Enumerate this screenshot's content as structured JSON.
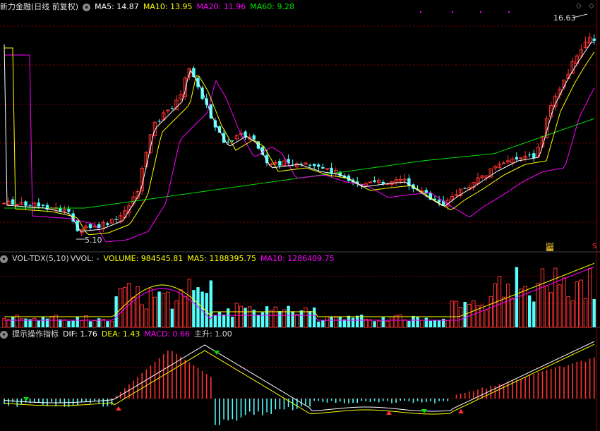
{
  "colors": {
    "up": "#ff3232",
    "down": "#54ffff",
    "ma5": "#ffffff",
    "ma10": "#ffff00",
    "ma20": "#ff00ff",
    "ma60": "#00e000",
    "grid": "#8b0000",
    "dif": "#ffffff",
    "dea": "#ffff00"
  },
  "price_panel": {
    "title": "新力金融(日线 前复权)",
    "ma5": "MA5: 14.87",
    "ma10": "MA10: 13.95",
    "ma20": "MA20: 11.96",
    "ma60": "MA60: 9.28",
    "high_label": "16.63",
    "low_label": "5.10",
    "side_marks": [
      "榜",
      "S"
    ],
    "icon": "chevron-down-icon"
  },
  "volume_panel": {
    "title": "VOL-TDX(5,10)",
    "vvol": "VVOL: -",
    "volume": "VOLUME: 984545.81",
    "ma5": "MA5: 1188395.75",
    "ma10": "MA10: 1286409.75",
    "icon": "chevron-down-icon"
  },
  "macd_panel": {
    "title": "提示操作指标",
    "dif": "DIF: 1.76",
    "dea": "DEA: 1.43",
    "macd": "MACD: 0.66",
    "zhusheng": "主升: 1.00",
    "icon": "chevron-down-icon"
  }
}
